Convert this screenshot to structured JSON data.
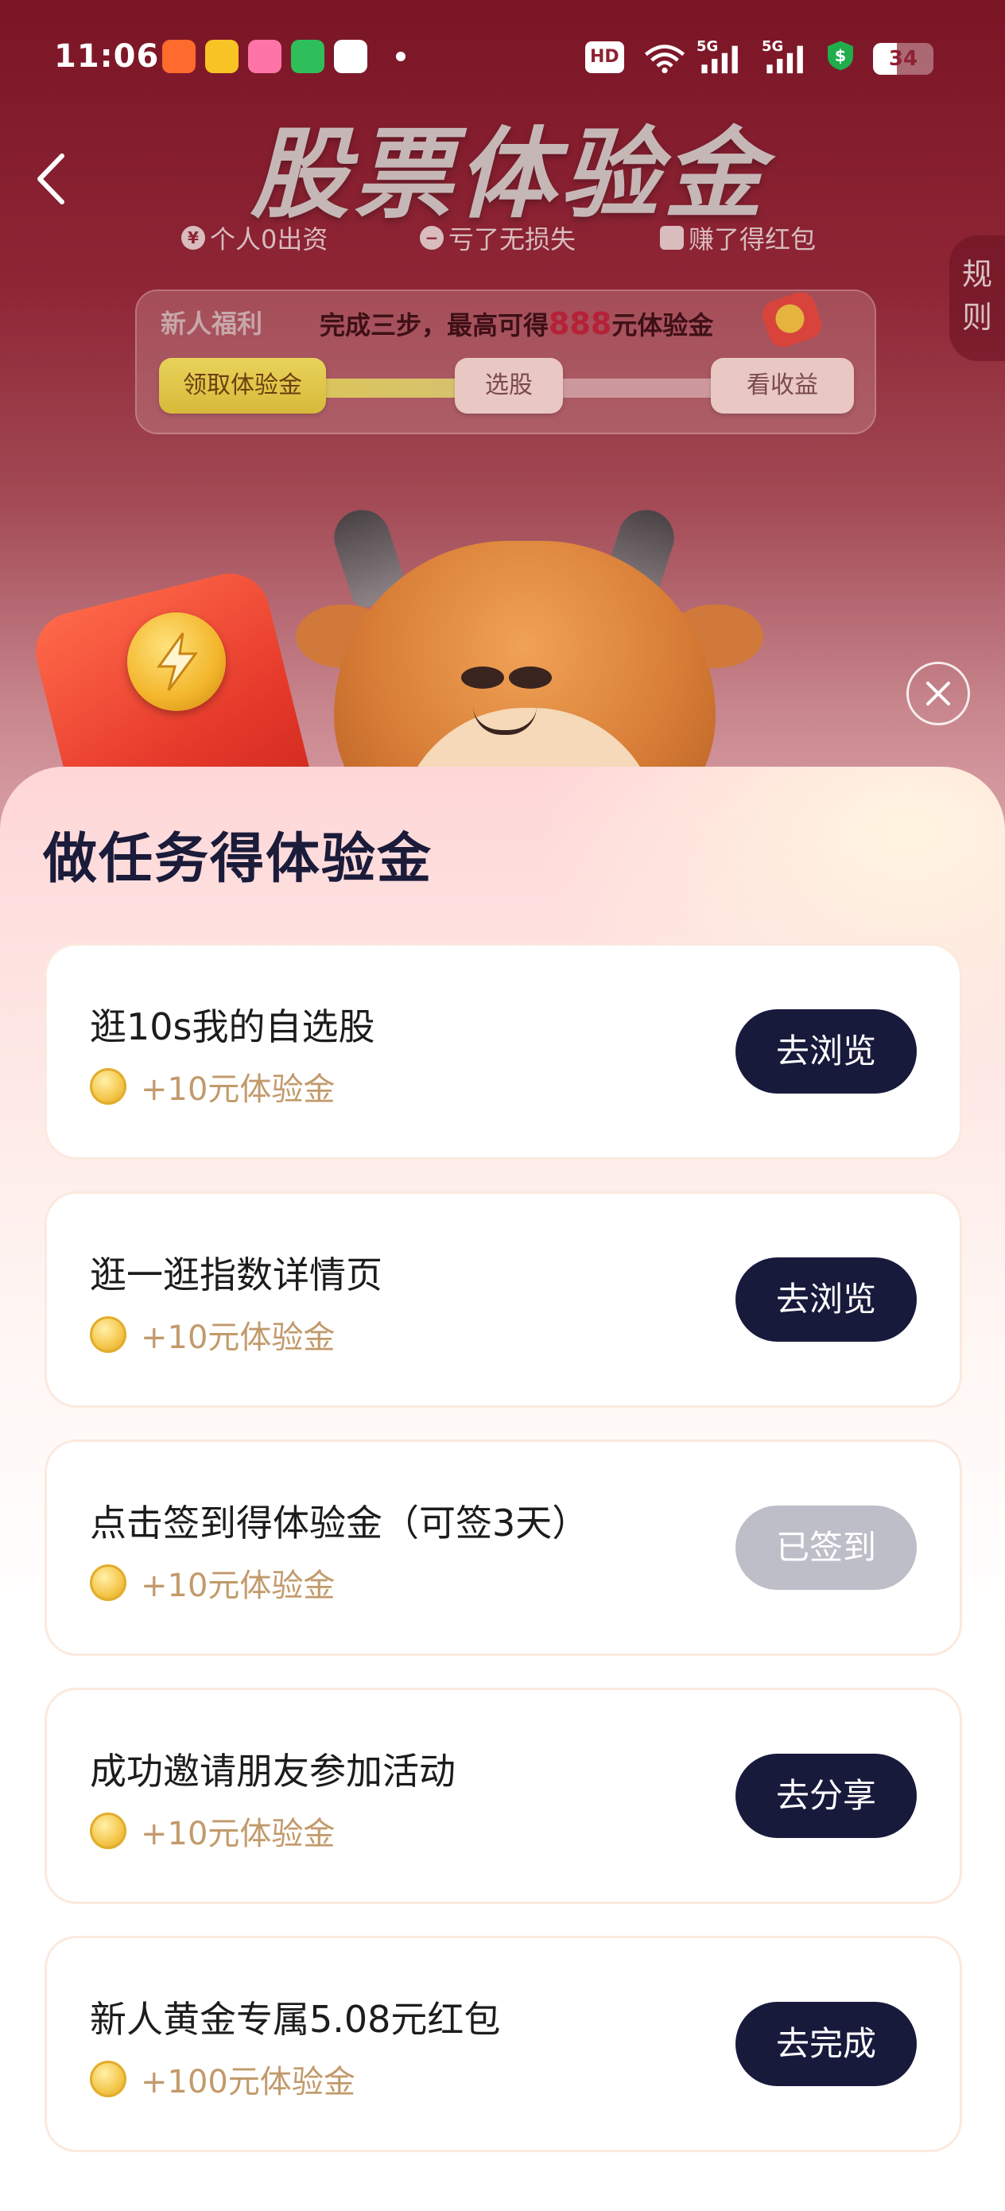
{
  "status_bar": {
    "time": "11:06",
    "hd_label": "HD",
    "signal_label_1": "5G",
    "signal_label_2": "5G",
    "battery": "34"
  },
  "header": {
    "title": "股票体验金",
    "features": [
      "个人0出资",
      "亏了无损失",
      "赚了得红包"
    ],
    "rules_label": "规则"
  },
  "progress": {
    "tag": "新人福利",
    "text_prefix": "完成三步，最高可得",
    "text_highlight": "888",
    "text_suffix": "元体验金",
    "steps": [
      "领取体验金",
      "选股",
      "看收益"
    ],
    "current_step": 1
  },
  "sheet": {
    "title": "做任务得体验金",
    "tasks": [
      {
        "name": "逛10s我的自选股",
        "reward": "+10元体验金",
        "button": "去浏览",
        "completed": false
      },
      {
        "name": "逛一逛指数详情页",
        "reward": "+10元体验金",
        "button": "去浏览",
        "completed": false
      },
      {
        "name": "点击签到得体验金（可签3天）",
        "reward": "+10元体验金",
        "button": "已签到",
        "completed": true
      },
      {
        "name": "成功邀请朋友参加活动",
        "reward": "+10元体验金",
        "button": "去分享",
        "completed": false
      },
      {
        "name": "新人黄金专属5.08元红包",
        "reward": "+100元体验金",
        "button": "去完成",
        "completed": false
      }
    ]
  },
  "colors": {
    "header_bg": "#8e2232",
    "button_dark": "#181a3c",
    "button_done": "#bdbec8",
    "reward_text": "#c29a6b",
    "highlight": "#b62137"
  }
}
